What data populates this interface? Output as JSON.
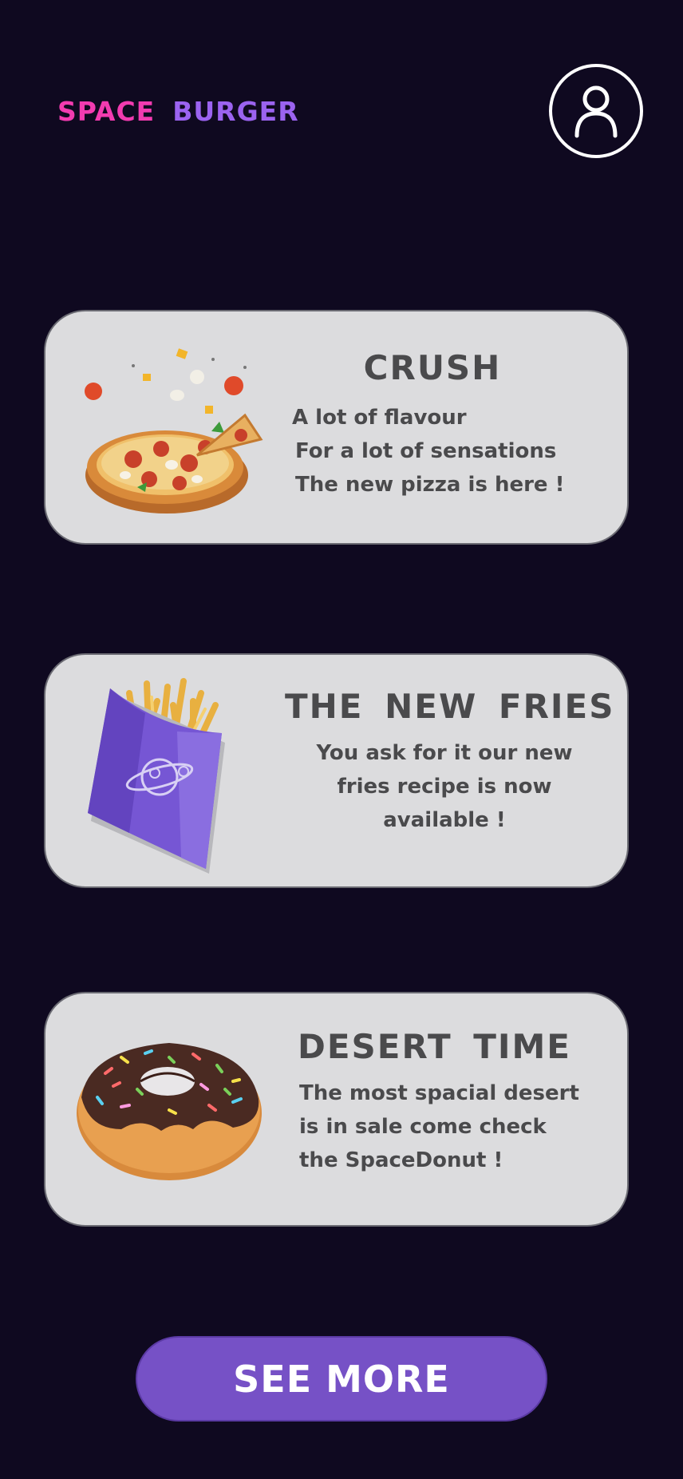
{
  "header": {
    "brand_word1": "SPACE",
    "brand_word2": "BURGER",
    "profile_icon": "user-profile-icon"
  },
  "cards": [
    {
      "title": "CRUSH",
      "lines": [
        "A lot of flavour",
        "For a lot of sensations",
        "The new pizza is here !"
      ],
      "image": "pizza-image"
    },
    {
      "title": "THE NEW FRIES",
      "lines": [
        "You ask for it our new",
        "fries recipe is now",
        "available !"
      ],
      "image": "fries-image"
    },
    {
      "title": "DESERT TIME",
      "lines": [
        "The most spacial desert",
        "is in sale come check",
        "the SpaceDonut !"
      ],
      "image": "donut-image"
    }
  ],
  "footer": {
    "see_more_label": "SEE MORE"
  },
  "colors": {
    "background": "#0f0920",
    "brand_pink": "#f23bb0",
    "brand_purple": "#9b63f0",
    "card_bg": "#dcdcde",
    "button_bg": "#7651c6"
  }
}
